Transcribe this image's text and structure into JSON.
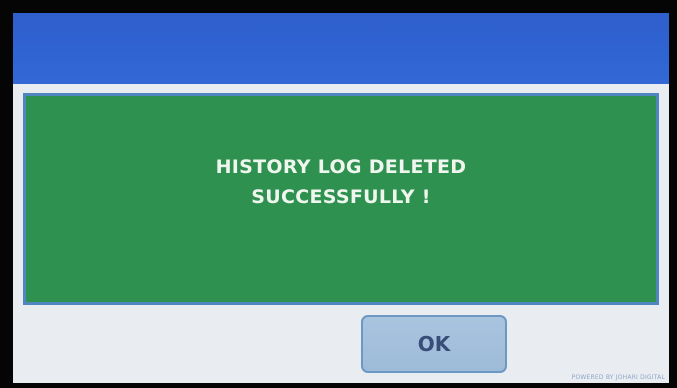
{
  "dialog": {
    "message_line_1": "HISTORY LOG DELETED",
    "message_line_2": "SUCCESSFULLY !",
    "ok_label": "OK"
  },
  "footer": {
    "credit": "POWERED BY JOHARI DIGITAL"
  },
  "colors": {
    "title_bar": "#2f63d1",
    "message_panel": "#2e9150",
    "panel_border": "#4f86bf",
    "button": "#a3c0dc",
    "background": "#e9ecf0"
  }
}
